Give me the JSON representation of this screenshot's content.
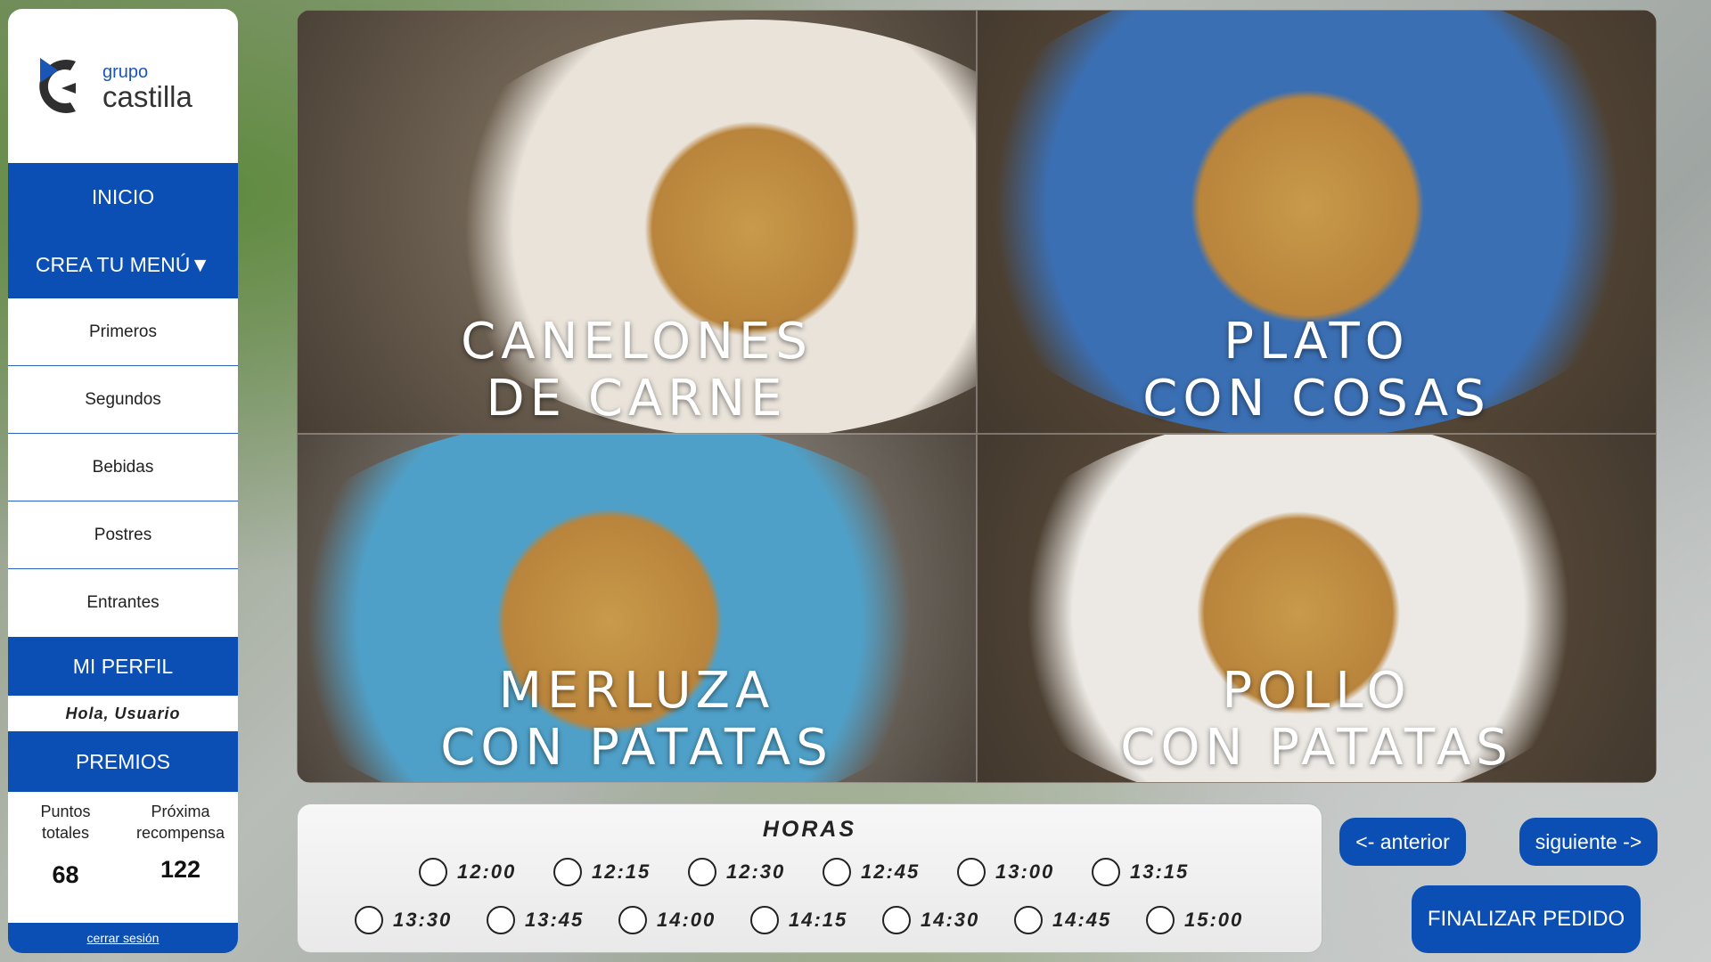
{
  "brand": {
    "small": "grupo",
    "big": "castilla"
  },
  "nav": {
    "inicio": "INICIO",
    "crea_menu": "CREA TU MENÚ▼",
    "items": [
      "Primeros",
      "Segundos",
      "Bebidas",
      "Postres",
      "Entrantes"
    ],
    "perfil": "MI PERFIL",
    "greeting": "Hola, Usuario",
    "premios": "PREMIOS",
    "points_label_1": "Puntos",
    "points_label_2": "totales",
    "next_label_1": "Próxima",
    "next_label_2": "recompensa",
    "points_value": "68",
    "next_value": "122",
    "logout": "cerrar sesión"
  },
  "dishes": [
    {
      "line1": "CANELONES",
      "line2": "DE CARNE",
      "plate_color": "#e9e3da",
      "bg_color": "#8a7c6a"
    },
    {
      "line1": "PLATO",
      "line2": "CON COSAS",
      "plate_color": "#3b6fb3",
      "bg_color": "#6d5b45"
    },
    {
      "line1": "MERLUZA",
      "line2": "CON PATATAS",
      "plate_color": "#4fa0c8",
      "bg_color": "#a8a49d"
    },
    {
      "line1": "POLLO",
      "line2": "CON PATATAS",
      "plate_color": "#ece9e4",
      "bg_color": "#6b5a47"
    }
  ],
  "hours": {
    "title": "HORAS",
    "row1": [
      "12:00",
      "12:15",
      "12:30",
      "12:45",
      "13:00",
      "13:15"
    ],
    "row2": [
      "13:30",
      "13:45",
      "14:00",
      "14:15",
      "14:30",
      "14:45",
      "15:00"
    ]
  },
  "buttons": {
    "prev": "<- anterior",
    "next": "siguiente ->",
    "finish": "FINALIZAR PEDIDO"
  },
  "colors": {
    "primary": "#0b4fb4"
  }
}
